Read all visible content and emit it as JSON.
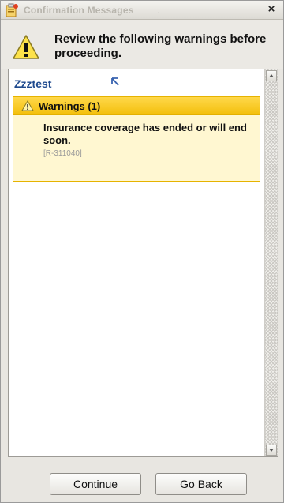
{
  "window": {
    "title": "Confirmation Messages",
    "title_dot": ".",
    "close_label": "×"
  },
  "header": {
    "message": "Review the following warnings before proceeding."
  },
  "patient": {
    "name": "Zzztest",
    "link_icon": "arrow-up-left-icon"
  },
  "warnings": {
    "title": "Warnings (1)",
    "items": [
      {
        "text": "Insurance coverage has ended or will end soon.",
        "code": "[R-311040]"
      }
    ]
  },
  "buttons": {
    "continue_label": "Continue",
    "go_back_label": "Go Back"
  },
  "colors": {
    "patient_name": "#1f4a8e",
    "warning_header": "#f3bf0c",
    "warning_bg": "#fff7d1"
  }
}
